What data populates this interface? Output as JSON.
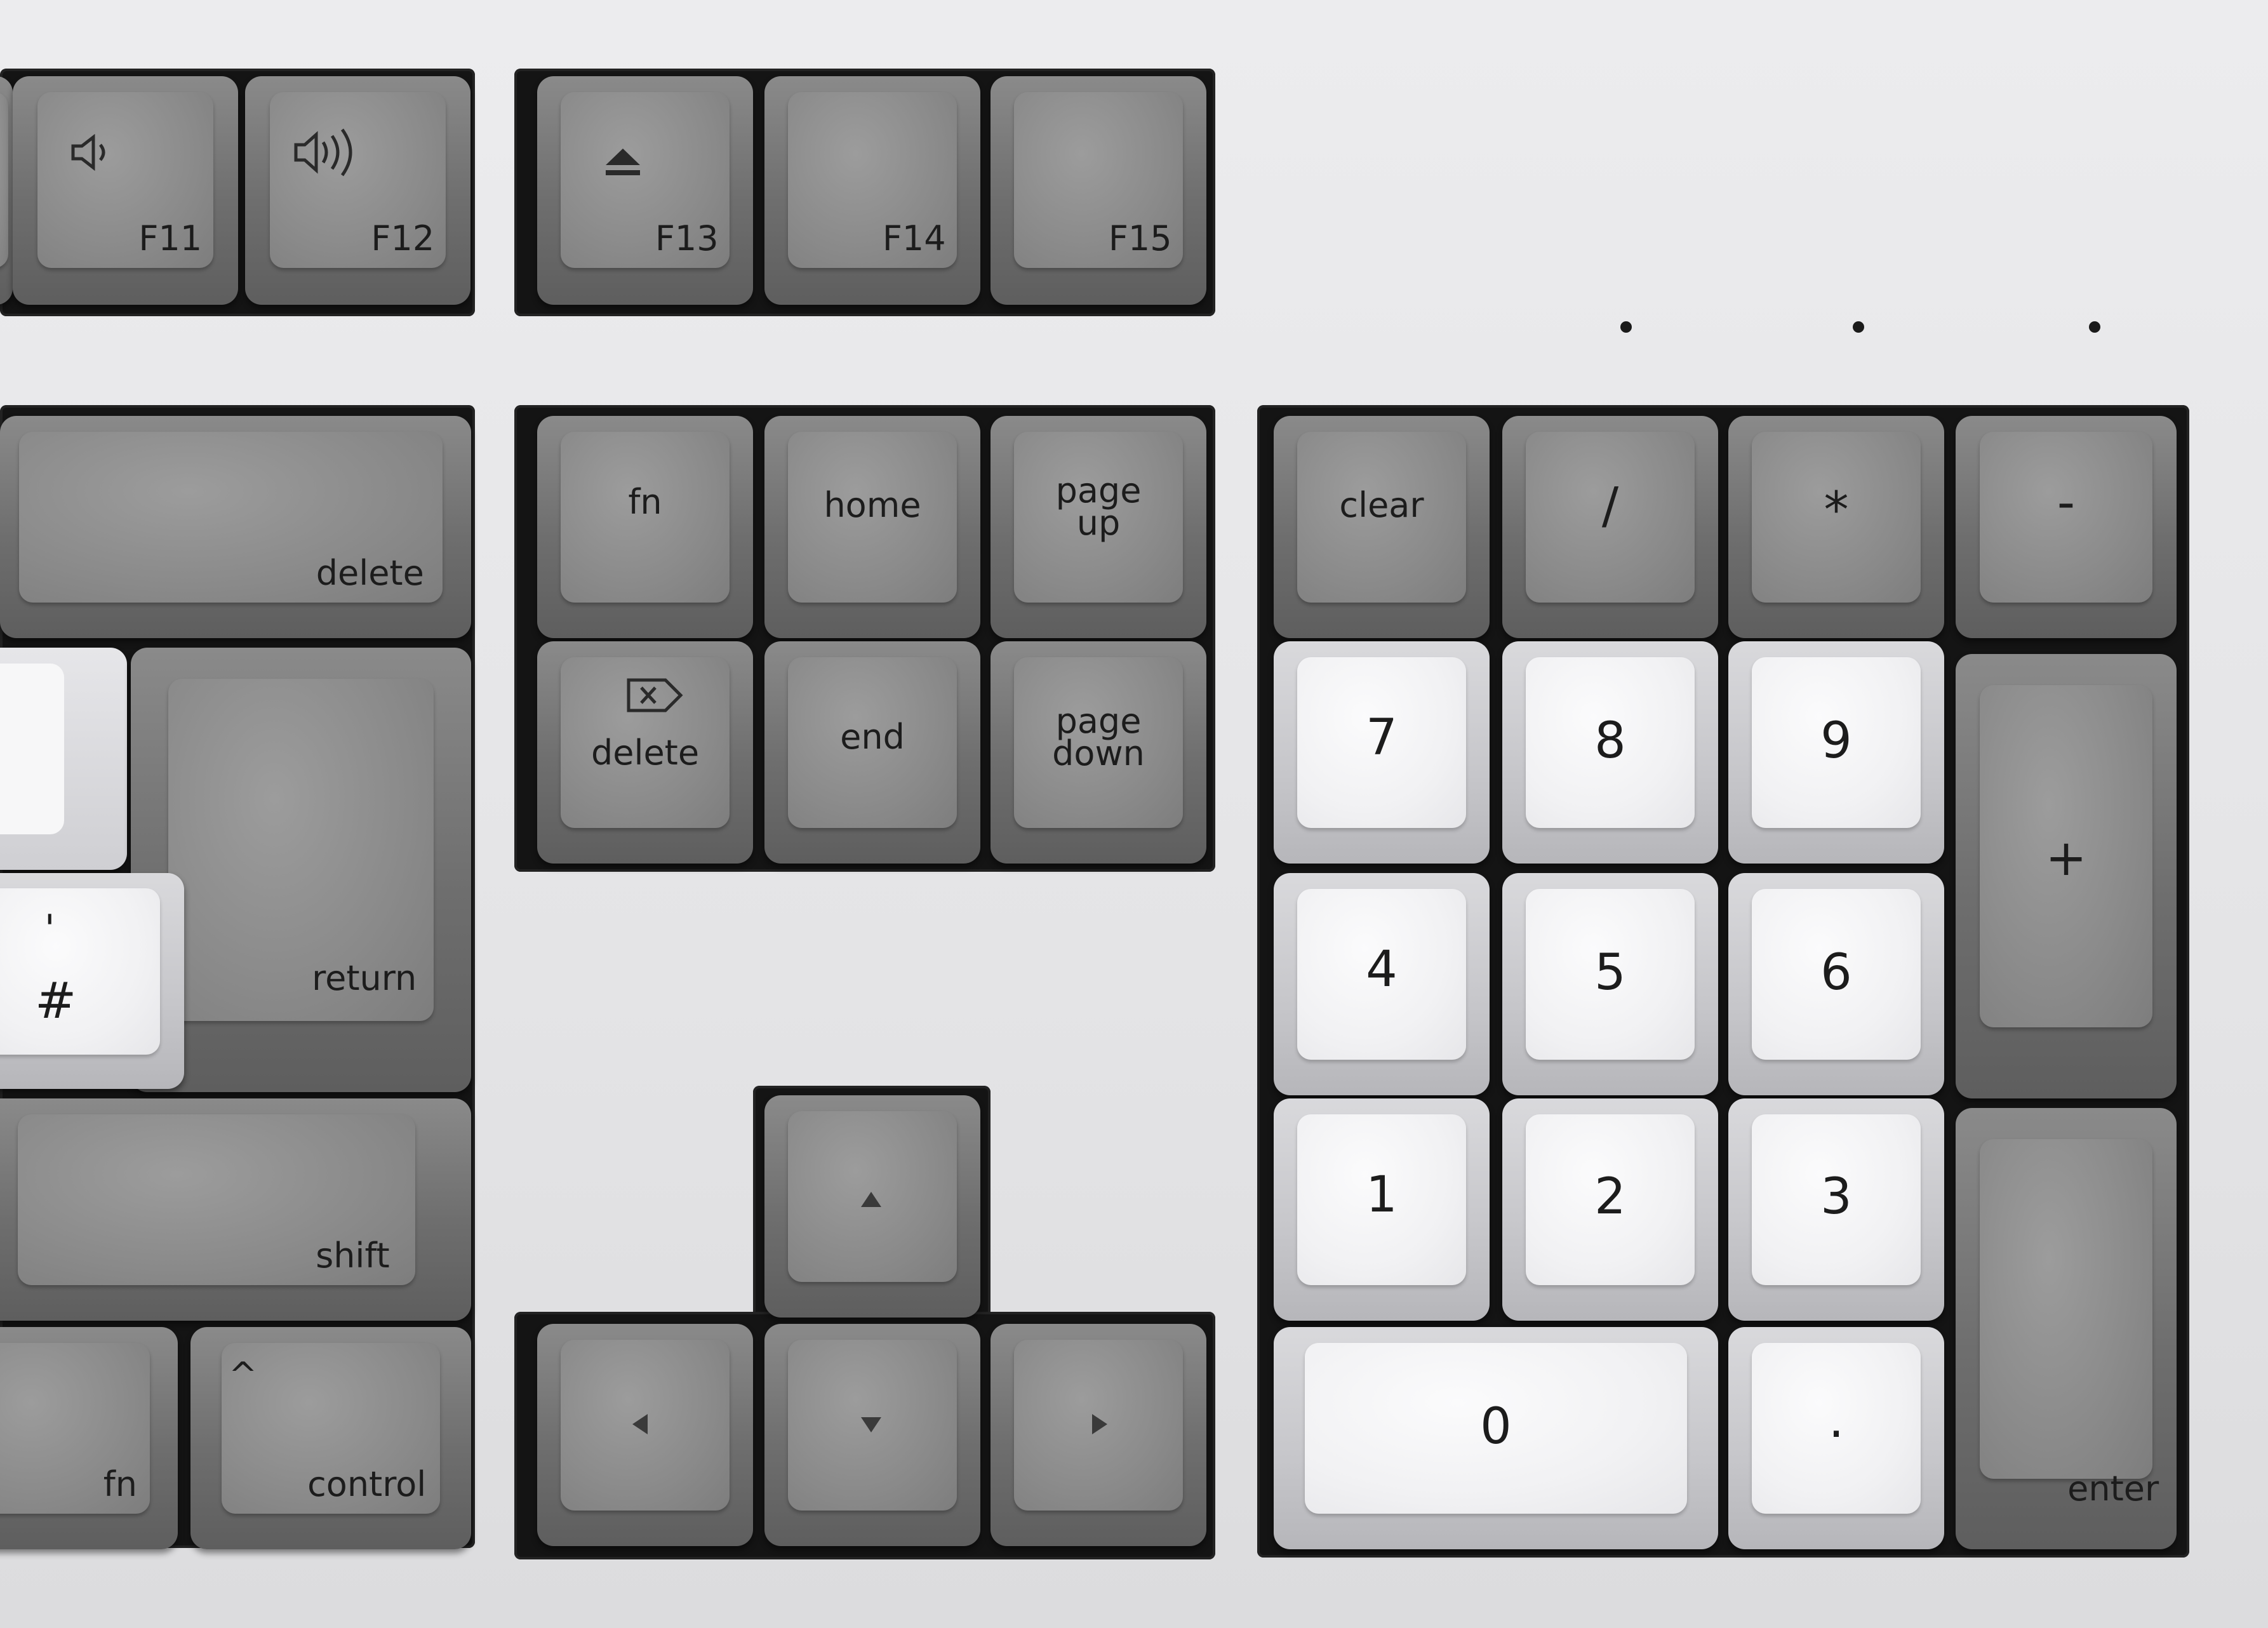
{
  "function_row": {
    "f11": "F11",
    "f12": "F12",
    "f13": "F13",
    "f14": "F14",
    "f15": "F15"
  },
  "main_block": {
    "delete": "delete",
    "return": "return",
    "hash_top": "'",
    "hash_bottom": "#",
    "shift": "shift",
    "fn": "fn",
    "control": "control",
    "control_symbol": "^"
  },
  "nav_cluster": {
    "fn": "fn",
    "home": "home",
    "page_up": "page\nup",
    "forward_delete": "delete",
    "end": "end",
    "page_down": "page\ndown"
  },
  "numpad": {
    "clear": "clear",
    "divide": "/",
    "multiply": "*",
    "minus": "-",
    "plus": "+",
    "seven": "7",
    "eight": "8",
    "nine": "9",
    "four": "4",
    "five": "5",
    "six": "6",
    "one": "1",
    "two": "2",
    "three": "3",
    "zero": "0",
    "decimal": ".",
    "enter": "enter"
  },
  "icons": {
    "volume_down": "volume-down-icon",
    "volume_up": "volume-up-icon",
    "eject": "eject-icon",
    "forward_delete": "forward-delete-icon",
    "arrow_up": "arrow-up-icon",
    "arrow_left": "arrow-left-icon",
    "arrow_down": "arrow-down-icon",
    "arrow_right": "arrow-right-icon"
  },
  "colors": {
    "case": "#e8e8ea",
    "dark_key": "#7a7a7a",
    "light_key": "#f1f1f3",
    "legend": "#1c1c1c"
  }
}
